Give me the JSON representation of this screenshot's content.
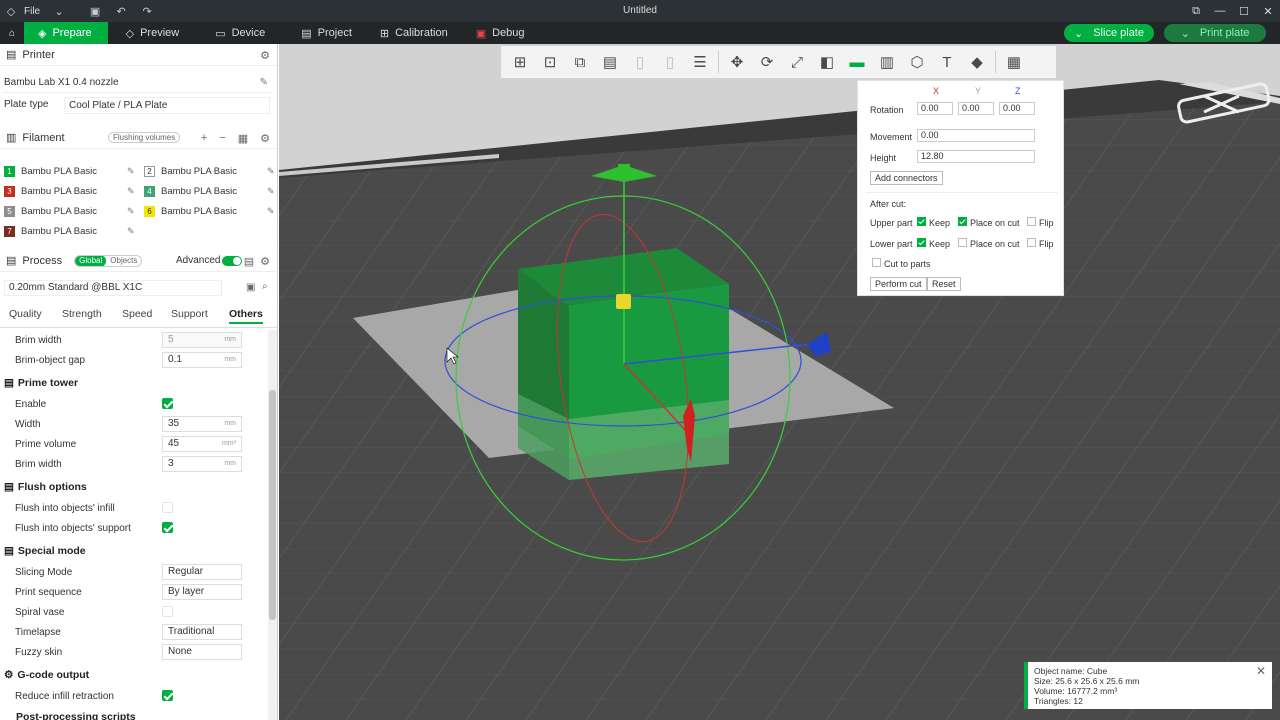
{
  "titlebar": {
    "file": "File",
    "title": "Untitled"
  },
  "nav": {
    "tabs": [
      {
        "label": "Prepare"
      },
      {
        "label": "Preview"
      },
      {
        "label": "Device"
      },
      {
        "label": "Project"
      },
      {
        "label": "Calibration"
      },
      {
        "label": "Debug"
      }
    ],
    "slice_label": "Slice plate",
    "print_label": "Print plate"
  },
  "printer": {
    "header": "Printer",
    "name": "Bambu Lab X1 0.4 nozzle",
    "plate_type_label": "Plate type",
    "plate_type": "Cool Plate / PLA Plate"
  },
  "filament": {
    "header": "Filament",
    "flushing_label": "Flushing volumes",
    "slots": [
      {
        "num": "1",
        "name": "Bambu PLA Basic",
        "color": "#00ae42"
      },
      {
        "num": "2",
        "name": "Bambu PLA Basic",
        "color": "#ffffff"
      },
      {
        "num": "3",
        "name": "Bambu PLA Basic",
        "color": "#c12e1f"
      },
      {
        "num": "4",
        "name": "Bambu PLA Basic",
        "color": "#3fa37a"
      },
      {
        "num": "5",
        "name": "Bambu PLA Basic",
        "color": "#8e8e8e"
      },
      {
        "num": "6",
        "name": "Bambu PLA Basic",
        "color": "#f3e600"
      },
      {
        "num": "7",
        "name": "Bambu PLA Basic",
        "color": "#7a2e22"
      }
    ]
  },
  "process": {
    "header": "Process",
    "global_label": "Global",
    "objects_label": "Objects",
    "advanced_label": "Advanced",
    "preset": "0.20mm Standard @BBL X1C",
    "subtabs": [
      "Quality",
      "Strength",
      "Speed",
      "Support",
      "Others"
    ],
    "brim_width_label": "Brim width",
    "brim_width": "5",
    "brim_gap_label": "Brim-object gap",
    "brim_gap": "0.1",
    "prime_tower": {
      "title": "Prime tower",
      "enable_label": "Enable",
      "width_label": "Width",
      "width": "35",
      "volume_label": "Prime volume",
      "volume": "45",
      "brim_label": "Brim width",
      "brim": "3"
    },
    "flush": {
      "title": "Flush options",
      "infill_label": "Flush into objects' infill",
      "support_label": "Flush into objects' support"
    },
    "special": {
      "title": "Special mode",
      "slicing_label": "Slicing Mode",
      "slicing": "Regular",
      "sequence_label": "Print sequence",
      "sequence": "By layer",
      "spiral_label": "Spiral vase",
      "timelapse_label": "Timelapse",
      "timelapse": "Traditional",
      "fuzzy_label": "Fuzzy skin",
      "fuzzy": "None"
    },
    "gcode": {
      "title": "G-code output",
      "retract_label": "Reduce infill retraction",
      "post_label": "Post-processing scripts"
    },
    "units": {
      "mm": "mm",
      "mm3": "mm³"
    }
  },
  "cut": {
    "x": "X",
    "y": "Y",
    "z": "Z",
    "rotation_label": "Rotation",
    "rot_x": "0.00",
    "rot_y": "0.00",
    "rot_z": "0.00",
    "movement_label": "Movement",
    "movement": "0.00",
    "height_label": "Height",
    "height": "12.80",
    "add_connectors": "Add connectors",
    "after_cut": "After cut:",
    "upper_part": "Upper part",
    "lower_part": "Lower part",
    "keep": "Keep",
    "place_on_cut": "Place on cut",
    "flip": "Flip",
    "cut_to_parts": "Cut to parts",
    "perform_cut": "Perform cut",
    "reset": "Reset"
  },
  "info": {
    "name": "Object name: Cube",
    "size": "Size: 25.6 x 25.6 x 25.6 mm",
    "volume": "Volume: 16777.2 mm³",
    "triangles": "Triangles: 12"
  }
}
